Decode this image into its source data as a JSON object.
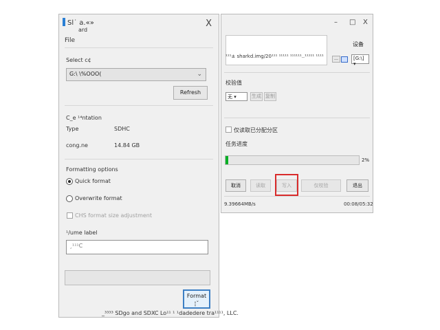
{
  "left_window": {
    "title": "Sl˙ a.«»",
    "title_line2": "ard",
    "close_glyph": "X",
    "menu": {
      "file": "File"
    },
    "select_card": {
      "label": "Select c¢",
      "value": "G:\\ \\%OOO(",
      "refresh_button": "Refresh"
    },
    "card_info": {
      "heading": "C_e ¹⁴ntation",
      "type_label": "Type",
      "type_value": "SDHC",
      "capacity_label": "cong.ne",
      "capacity_value": "14.84 GB"
    },
    "formatting": {
      "heading": "Formatting options",
      "quick": "Quick format",
      "overwrite": "Overwrite format",
      "chs": "CHS format size adjustment",
      "volume_label": "¹/ume label",
      "volume_value": "¸¹¹¹C"
    },
    "format_button": "Format",
    "format_button_line2": "¦ˇ",
    "footer": "_³³³³ SDgo and SDXC Lo¹¹ ¹ ¹dadedere tra¹¹¹¹, LLC."
  },
  "right_window": {
    "controls": {
      "minimize": "–",
      "maximize": "□",
      "close": "X"
    },
    "path": "¹¹¹± sharkd.img/20¹¹¹ ¹¹¹¹¹ ¹¹¹¹¹¹..¹¹¹¹¹ ¹¹¹¹",
    "device_label": "设备",
    "device_value": "[G:\\] ▾",
    "hash_label": "校验值",
    "hash_value": "无 ▾",
    "generate_button": "生成",
    "copy_button": "复制",
    "read_partition_checkbox": "仅读取已分配分区",
    "progress_label": "任务进度",
    "progress_percent": 2,
    "progress_text": "2%",
    "buttons": {
      "cancel": "取消",
      "read": "读取",
      "write": "写入",
      "verify_only": "仅校验",
      "exit": "退出"
    },
    "speed": "9.39664MB/s",
    "time": "00:08/05:32"
  }
}
